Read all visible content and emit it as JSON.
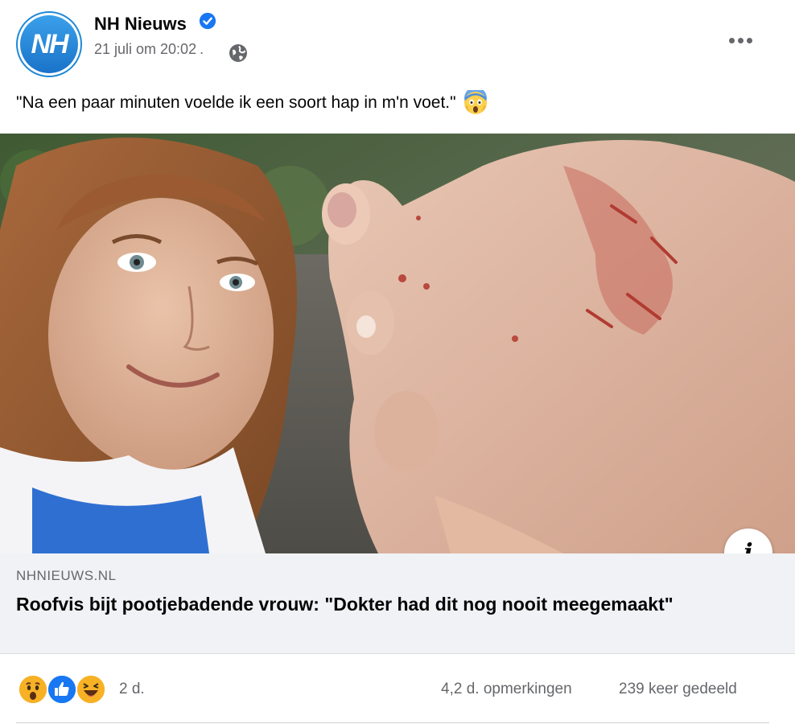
{
  "post": {
    "page_name": "NH Nieuws",
    "avatar_text": "NH",
    "timestamp": "21 juli om 20:02",
    "meta_separator": ".",
    "text": "\"Na een paar minuten voelde ik een soort hap in m'n voet.\"",
    "emoji": "scream-emoji",
    "image_icon": "info-icon",
    "icons": {
      "verified": "verified-badge-icon",
      "globe": "globe-icon",
      "more": "more-options-icon"
    }
  },
  "link_preview": {
    "domain": "NHNIEUWS.NL",
    "title": "Roofvis bijt pootjebadende vrouw: \"Dokter had dit nog nooit meegemaakt\""
  },
  "engagement": {
    "reactions": [
      "wow",
      "like",
      "haha"
    ],
    "reaction_count": "2 d.",
    "comments": "4,2 d. opmerkingen",
    "shares": "239 keer gedeeld"
  },
  "colors": {
    "brand_blue": "#1877f2",
    "secondary_text": "#65676b",
    "link_bg": "#f0f2f5",
    "nh_blue": "#1a73c9"
  }
}
